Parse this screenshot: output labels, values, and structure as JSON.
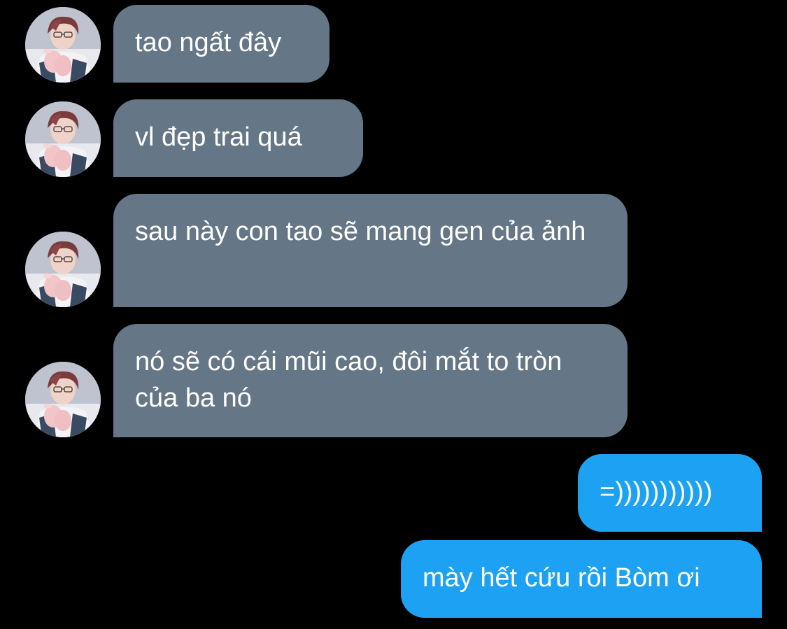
{
  "conversation": {
    "received": [
      {
        "text": "tao ngất đây",
        "avatar_icon": "avatar-photo"
      },
      {
        "text": "vl đẹp trai quá",
        "avatar_icon": "avatar-photo"
      },
      {
        "text": "sau này con tao sẽ mang gen của ảnh",
        "avatar_icon": "avatar-photo"
      },
      {
        "text": "nó sẽ có cái mũi cao, đôi mắt to tròn của ba nó",
        "avatar_icon": "avatar-photo"
      }
    ],
    "sent": [
      {
        "text": "=)))))))))))"
      },
      {
        "text": "mày hết cứu rồi Bòm ơi"
      }
    ]
  },
  "colors": {
    "background": "#000000",
    "received_bubble": "#657786",
    "sent_bubble": "#1da1f2",
    "text": "#ffffff"
  }
}
